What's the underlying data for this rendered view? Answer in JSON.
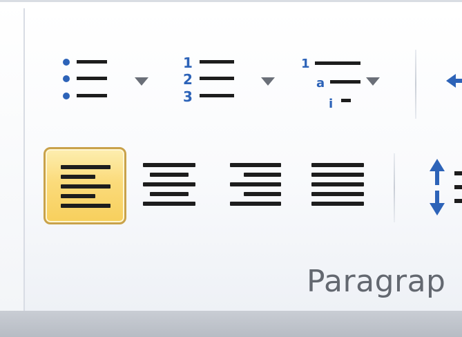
{
  "ribbon": {
    "group_label": "Paragrap",
    "buttons": {
      "bullets": {
        "label": "Bullets",
        "icon": "bullet-list-icon",
        "has_dropdown": true
      },
      "numbering": {
        "label": "Numbering",
        "icon": "numbered-list-icon",
        "has_dropdown": true
      },
      "multilevel": {
        "label": "Multilevel List",
        "icon": "multilevel-list-icon",
        "has_dropdown": true
      },
      "align_left": {
        "label": "Align Text Left",
        "icon": "align-left-icon",
        "selected": true
      },
      "center": {
        "label": "Center",
        "icon": "align-center-icon",
        "selected": false
      },
      "align_right": {
        "label": "Align Text Right",
        "icon": "align-right-icon",
        "selected": false
      },
      "justify": {
        "label": "Justify",
        "icon": "justify-icon",
        "selected": false
      }
    },
    "numbering_glyphs": [
      "1",
      "2",
      "3"
    ],
    "multilevel_glyphs": [
      "1",
      "a",
      "i"
    ],
    "colors": {
      "selected_fill": "#fbdb7b",
      "selected_border": "#c9a24a",
      "icon_blue": "#2d63b8",
      "label_gray": "#636870"
    }
  }
}
